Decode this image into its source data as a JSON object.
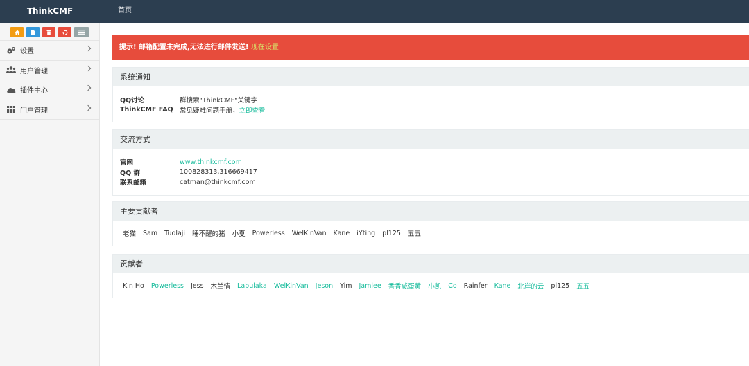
{
  "header": {
    "brand": "ThinkCMF",
    "nav_home": "首页"
  },
  "sidebar": {
    "shortcuts": [
      "home-icon",
      "file-icon",
      "trash-icon",
      "recycle-icon",
      "list-icon"
    ],
    "items": [
      {
        "label": "设置",
        "icon": "gears-icon"
      },
      {
        "label": "用户管理",
        "icon": "users-icon"
      },
      {
        "label": "插件中心",
        "icon": "cloud-icon"
      },
      {
        "label": "门户管理",
        "icon": "grid-icon"
      }
    ]
  },
  "alert": {
    "text": "提示! 邮箱配置未完成,无法进行邮件发送!",
    "link": "现在设置"
  },
  "notice": {
    "title": "系统通知",
    "rows": [
      {
        "key": "QQ讨论",
        "value": "群搜索\"ThinkCMF\"关键字",
        "link": ""
      },
      {
        "key": "ThinkCMF FAQ",
        "value": "常见疑难问题手册，",
        "link": "立即查看"
      }
    ]
  },
  "contact": {
    "title": "交流方式",
    "rows": [
      {
        "key": "官网",
        "value": "www.thinkcmf.com"
      },
      {
        "key": "QQ 群",
        "value": "100828313,316669417"
      },
      {
        "key": "联系邮箱",
        "value": "catman@thinkcmf.com"
      }
    ]
  },
  "main_contributors": {
    "title": "主要贡献者",
    "names": [
      "老猫",
      "Sam",
      "Tuolaji",
      "睡不醒的猪",
      "小夏",
      "Powerless",
      "WelKinVan",
      "Kane",
      "iYting",
      "pl125",
      "五五"
    ]
  },
  "contributors": {
    "title": "贡献者",
    "names": [
      {
        "name": "Kin Ho",
        "style": "plain"
      },
      {
        "name": "Powerless",
        "style": "link"
      },
      {
        "name": "Jess",
        "style": "plain"
      },
      {
        "name": "木兰情",
        "style": "plain"
      },
      {
        "name": "Labulaka",
        "style": "link"
      },
      {
        "name": "WelKinVan",
        "style": "link"
      },
      {
        "name": "Jeson",
        "style": "underline"
      },
      {
        "name": "Yim",
        "style": "plain"
      },
      {
        "name": "Jamlee",
        "style": "link"
      },
      {
        "name": "香香咸蛋黄",
        "style": "link"
      },
      {
        "name": "小凯",
        "style": "link"
      },
      {
        "name": "Co",
        "style": "link"
      },
      {
        "name": "Rainfer",
        "style": "plain"
      },
      {
        "name": "Kane",
        "style": "link"
      },
      {
        "name": "北岸的云",
        "style": "link"
      },
      {
        "name": "pl125",
        "style": "plain"
      },
      {
        "name": "五五",
        "style": "link"
      }
    ]
  },
  "colors": {
    "topbar": "#2c3e50",
    "alert": "#e74c3c",
    "link": "#18bc9c"
  }
}
